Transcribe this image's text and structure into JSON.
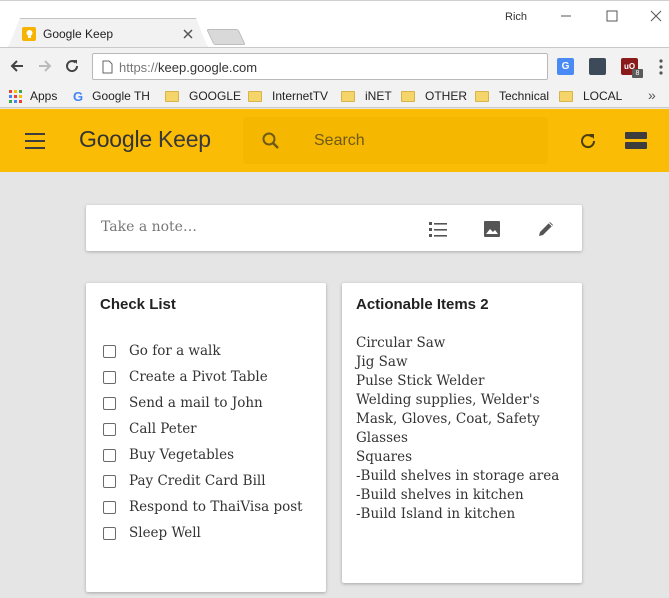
{
  "browser": {
    "tab_title": "Google Keep",
    "profile_name": "Rich",
    "url_protocol": "https://",
    "url_host": "keep.google.com",
    "extension_badge": "8",
    "bookmarks": [
      {
        "label": "Apps",
        "icon": "apps-grid-icon"
      },
      {
        "label": "Google TH",
        "icon": "google-icon"
      },
      {
        "label": "GOOGLE",
        "icon": "folder-icon"
      },
      {
        "label": "InternetTV",
        "icon": "folder-icon"
      },
      {
        "label": "iNET",
        "icon": "folder-icon"
      },
      {
        "label": "OTHER",
        "icon": "folder-icon"
      },
      {
        "label": "Technical",
        "icon": "folder-icon"
      },
      {
        "label": "LOCAL",
        "icon": "folder-icon"
      }
    ],
    "more_bookmarks": "»"
  },
  "keep": {
    "logo_google": "Google",
    "logo_keep": "Keep",
    "search_placeholder": "Search",
    "take_note_placeholder": "Take a note…",
    "accent_color": "#fbbc05"
  },
  "notes": [
    {
      "title": "Check List",
      "type": "checklist",
      "items": [
        "Go for a walk",
        "Create a Pivot Table",
        "Send a mail to John",
        "Call Peter",
        "Buy Vegetables",
        "Pay Credit Card Bill",
        "Respond to ThaiVisa post",
        "Sleep Well"
      ]
    },
    {
      "title": "Actionable Items 2",
      "type": "text",
      "lines": [
        "Circular Saw",
        "Jig Saw",
        "Pulse Stick Welder",
        "Welding supplies, Welder's",
        "Mask, Gloves, Coat, Safety",
        "Glasses",
        "Squares",
        "-Build shelves in storage area",
        "-Build shelves in kitchen",
        "-Build Island in kitchen"
      ]
    }
  ]
}
